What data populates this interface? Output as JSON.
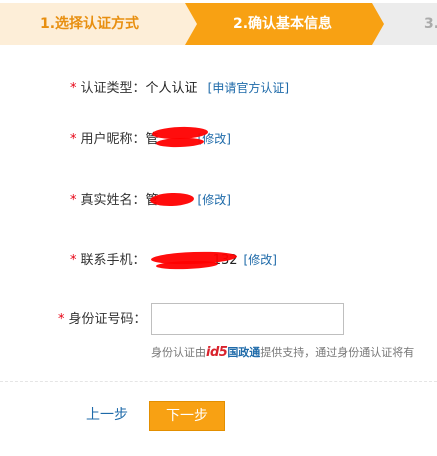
{
  "steps": [
    {
      "label": "1.选择认证方式"
    },
    {
      "label": "2.确认基本信息"
    },
    {
      "label": "3."
    }
  ],
  "form": {
    "cert_type": {
      "star": "*",
      "label": "认证类型：",
      "value": "个人认证",
      "link": "[申请官方认证]"
    },
    "nickname": {
      "star": "*",
      "label": "用户昵称：",
      "value_visible": "管",
      "link": "[修改]"
    },
    "real_name": {
      "star": "*",
      "label": "真实姓名：",
      "value_visible": "管",
      "link": "[修改]"
    },
    "phone": {
      "star": "*",
      "label": "联系手机：",
      "value_visible": "132",
      "link": "[修改]"
    },
    "id_number": {
      "star": "*",
      "label": "身份证号码：",
      "value": "",
      "placeholder": ""
    },
    "hint": {
      "prefix": "身份认证由",
      "logo_text": "id5",
      "brand": "国政通",
      "suffix": "提供支持，通过身份通认证将有"
    }
  },
  "actions": {
    "prev": "上一步",
    "next": "下一步"
  },
  "colors": {
    "accent": "#f8a113",
    "link": "#1e6aa9",
    "required": "#e60012",
    "redaction": "#ff0000"
  }
}
